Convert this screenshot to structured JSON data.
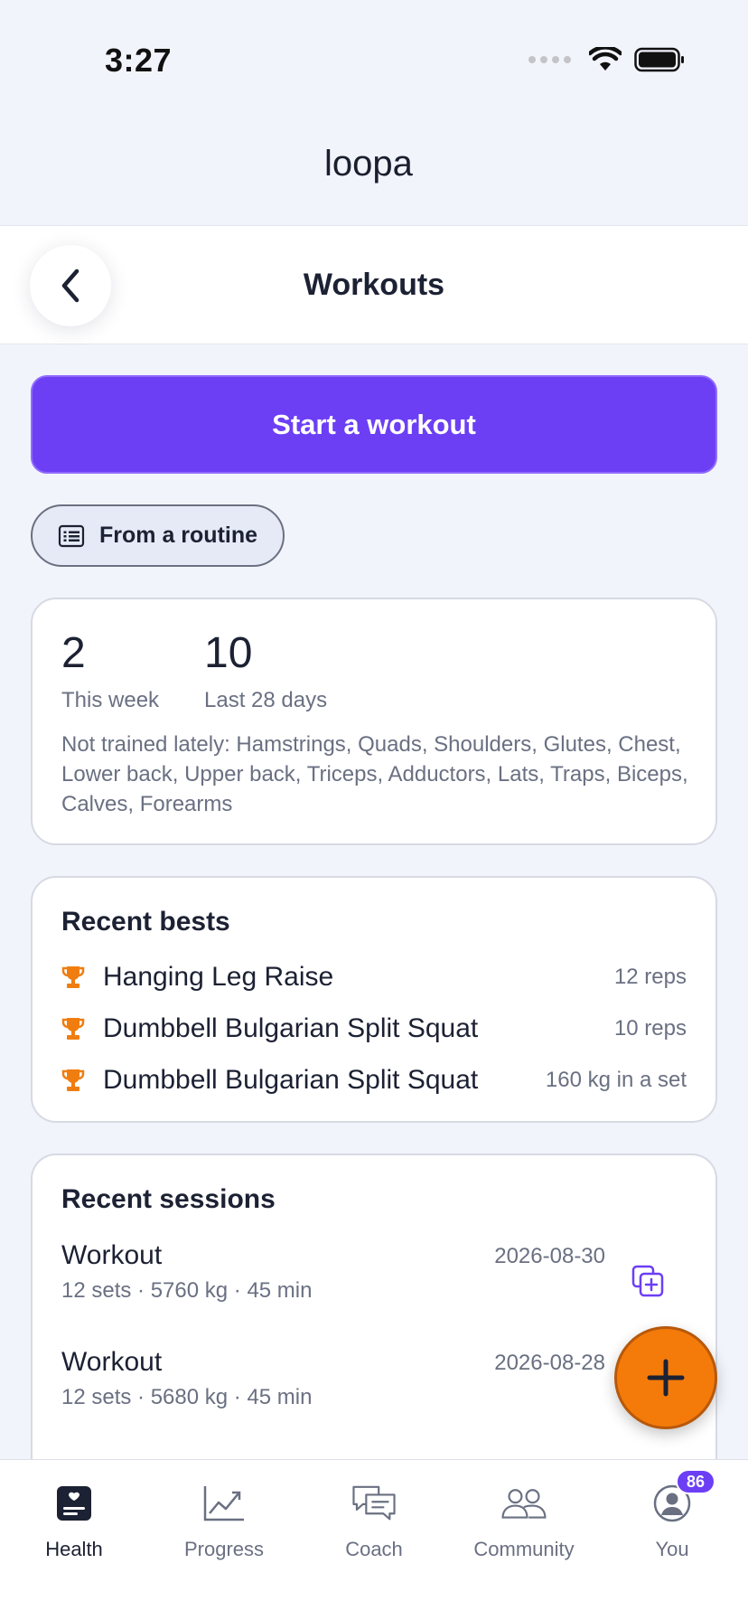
{
  "status_bar": {
    "time": "3:27"
  },
  "app": {
    "logo_text": "loopa"
  },
  "header": {
    "title": "Workouts"
  },
  "actions": {
    "start_label": "Start a workout",
    "routine_label": "From a routine"
  },
  "stats": {
    "this_week_value": "2",
    "this_week_label": "This week",
    "last28_value": "10",
    "last28_label": "Last 28 days",
    "not_trained": "Not trained lately: Hamstrings, Quads, Shoulders, Glutes, Chest, Lower back, Upper back, Triceps, Adductors, Lats, Traps, Biceps, Calves, Forearms"
  },
  "recent_bests": {
    "heading": "Recent bests",
    "items": [
      {
        "name": "Hanging Leg Raise",
        "value": "12 reps"
      },
      {
        "name": "Dumbbell Bulgarian Split Squat",
        "value": "10 reps"
      },
      {
        "name": "Dumbbell Bulgarian Split Squat",
        "value": "160 kg in a set"
      }
    ]
  },
  "recent_sessions": {
    "heading": "Recent sessions",
    "items": [
      {
        "title": "Workout",
        "meta": "12 sets · 5760 kg · 45 min",
        "date": "2026-08-30"
      },
      {
        "title": "Workout",
        "meta": "12 sets · 5680 kg · 45 min",
        "date": "2026-08-28"
      }
    ]
  },
  "bottom_nav": {
    "items": [
      {
        "label": "Health",
        "icon": "health-icon",
        "active": true
      },
      {
        "label": "Progress",
        "icon": "chart-icon"
      },
      {
        "label": "Coach",
        "icon": "chat-icon"
      },
      {
        "label": "Community",
        "icon": "people-icon"
      },
      {
        "label": "You",
        "icon": "profile-icon",
        "badge": "86"
      }
    ]
  },
  "colors": {
    "accent": "#6c3ff5",
    "fab": "#f47b0a",
    "trophy": "#f07d0f",
    "background": "#f2f4fc"
  }
}
